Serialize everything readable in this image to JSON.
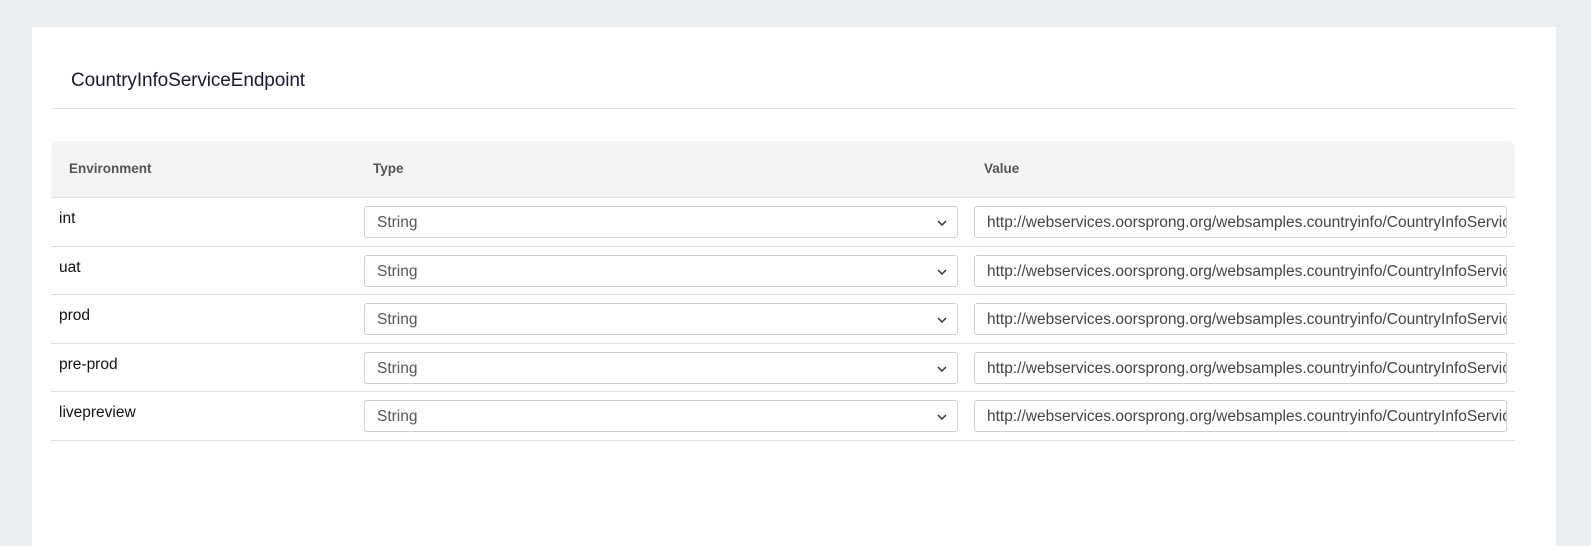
{
  "title": "CountryInfoServiceEndpoint",
  "columns": {
    "environment": "Environment",
    "type": "Type",
    "value": "Value"
  },
  "rows": [
    {
      "env": "int",
      "type": "String",
      "value": "http://webservices.oorsprong.org/websamples.countryinfo/CountryInfoService.wso"
    },
    {
      "env": "uat",
      "type": "String",
      "value": "http://webservices.oorsprong.org/websamples.countryinfo/CountryInfoService.wso"
    },
    {
      "env": "prod",
      "type": "String",
      "value": "http://webservices.oorsprong.org/websamples.countryinfo/CountryInfoService.wso"
    },
    {
      "env": "pre-prod",
      "type": "String",
      "value": "http://webservices.oorsprong.org/websamples.countryinfo/CountryInfoService.wso"
    },
    {
      "env": "livepreview",
      "type": "String",
      "value": "http://webservices.oorsprong.org/websamples.countryinfo/CountryInfoService.wso"
    }
  ],
  "icons": {
    "dropdown": "chevron-down-icon"
  }
}
